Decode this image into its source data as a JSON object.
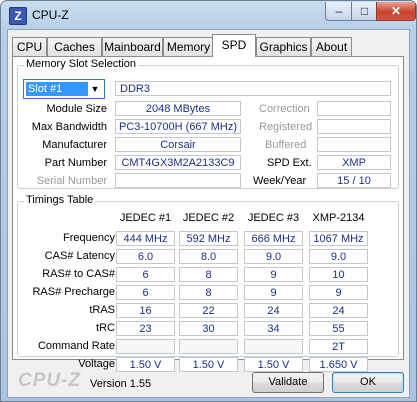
{
  "window": {
    "title": "CPU-Z",
    "icon_letter": "Z",
    "min_symbol": "–",
    "max_symbol": "□",
    "close_symbol": "✕"
  },
  "tabs": [
    "CPU",
    "Caches",
    "Mainboard",
    "Memory",
    "SPD",
    "Graphics",
    "About"
  ],
  "active_tab": "SPD",
  "memory_slot": {
    "group_label": "Memory Slot Selection",
    "slot_selected": "Slot #1",
    "memory_type": "DDR3",
    "labels": {
      "module_size": "Module Size",
      "max_bandwidth": "Max Bandwidth",
      "manufacturer": "Manufacturer",
      "part_number": "Part Number",
      "serial_number": "Serial Number",
      "correction": "Correction",
      "registered": "Registered",
      "buffered": "Buffered",
      "spd_ext": "SPD Ext.",
      "week_year": "Week/Year"
    },
    "values": {
      "module_size": "2048 MBytes",
      "max_bandwidth": "PC3-10700H (667 MHz)",
      "manufacturer": "Corsair",
      "part_number": "CMT4GX3M2A2133C9",
      "serial_number": "",
      "correction": "",
      "registered": "",
      "buffered": "",
      "spd_ext": "XMP",
      "week_year": "15 / 10"
    }
  },
  "timings": {
    "group_label": "Timings Table",
    "columns": [
      "JEDEC #1",
      "JEDEC #2",
      "JEDEC #3",
      "XMP-2134"
    ],
    "rows": [
      {
        "label": "Frequency",
        "values": [
          "444 MHz",
          "592 MHz",
          "666 MHz",
          "1067 MHz"
        ]
      },
      {
        "label": "CAS# Latency",
        "values": [
          "6.0",
          "8.0",
          "9.0",
          "9.0"
        ]
      },
      {
        "label": "RAS# to CAS#",
        "values": [
          "6",
          "8",
          "9",
          "10"
        ]
      },
      {
        "label": "RAS# Precharge",
        "values": [
          "6",
          "8",
          "9",
          "9"
        ]
      },
      {
        "label": "tRAS",
        "values": [
          "16",
          "22",
          "24",
          "24"
        ]
      },
      {
        "label": "tRC",
        "values": [
          "23",
          "30",
          "34",
          "55"
        ]
      },
      {
        "label": "Command Rate",
        "values": [
          "",
          "",
          "",
          "2T"
        ]
      },
      {
        "label": "Voltage",
        "values": [
          "1.50 V",
          "1.50 V",
          "1.50 V",
          "1.650 V"
        ]
      }
    ]
  },
  "footer": {
    "logo": "CPU-Z",
    "version": "Version 1.55",
    "validate_label": "Validate",
    "ok_label": "OK"
  }
}
